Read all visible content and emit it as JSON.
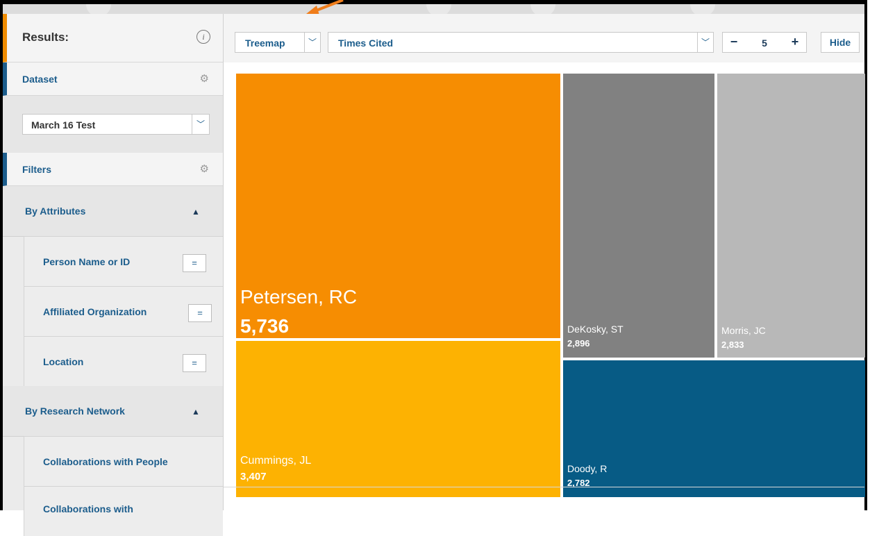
{
  "sidebar": {
    "results_label": "Results:",
    "info_icon": "i",
    "dataset_label": "Dataset",
    "dataset_selected": "March 16 Test",
    "filters_label": "Filters",
    "by_attributes": {
      "label": "By Attributes",
      "items": [
        {
          "label": "Person Name or ID",
          "operator": "="
        },
        {
          "label": "Affiliated Organization",
          "operator": "="
        },
        {
          "label": "Location",
          "operator": "="
        }
      ]
    },
    "by_research_network": {
      "label": "By Research Network",
      "items": [
        {
          "label": "Collaborations with People"
        },
        {
          "label": "Collaborations with"
        }
      ]
    }
  },
  "toolbar": {
    "view_type": "Treemap",
    "metric": "Times Cited",
    "count": "5",
    "minus": "−",
    "plus": "+",
    "hide_label": "Hide"
  },
  "chart_data": {
    "type": "treemap",
    "title": "",
    "items": [
      {
        "name": "Petersen, RC",
        "value": 5736,
        "label": "5,736",
        "color": "#f68d02"
      },
      {
        "name": "Cummings, JL",
        "value": 3407,
        "label": "3,407",
        "color": "#fdb202"
      },
      {
        "name": "DeKosky, ST",
        "value": 2896,
        "label": "2,896",
        "color": "#818181"
      },
      {
        "name": "Morris, JC",
        "value": 2833,
        "label": "2,833",
        "color": "#b8b8b8"
      },
      {
        "name": "Doody, R",
        "value": 2782,
        "label": "2,782",
        "color": "#075b85"
      }
    ]
  },
  "colors": {
    "accent": "#f08c00",
    "primary_text": "#1c5d8c"
  }
}
